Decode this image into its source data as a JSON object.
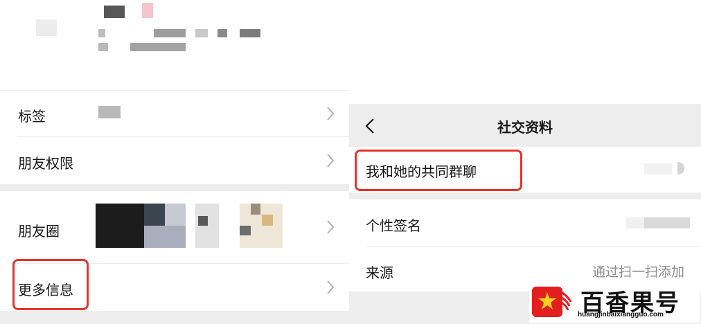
{
  "left": {
    "rows": {
      "tags": "标签",
      "friend_permissions": "朋友权限",
      "moments": "朋友圈",
      "more_info": "更多信息"
    }
  },
  "right": {
    "title": "社交资料",
    "rows": {
      "common_groups": "我和她的共同群聊",
      "signature": "个性签名",
      "source": "来源",
      "source_value": "通过扫一扫添加"
    }
  },
  "watermark": {
    "brand": "百香果号",
    "url": "huangjinbaixiangguo.com"
  },
  "colors": {
    "highlight": "#e8322b",
    "gap": "#ededed",
    "text": "#191919",
    "secondary": "#8c8c8c"
  },
  "icons": [
    "chevron-right-icon",
    "back-arrow-icon",
    "brand-logo-icon"
  ]
}
